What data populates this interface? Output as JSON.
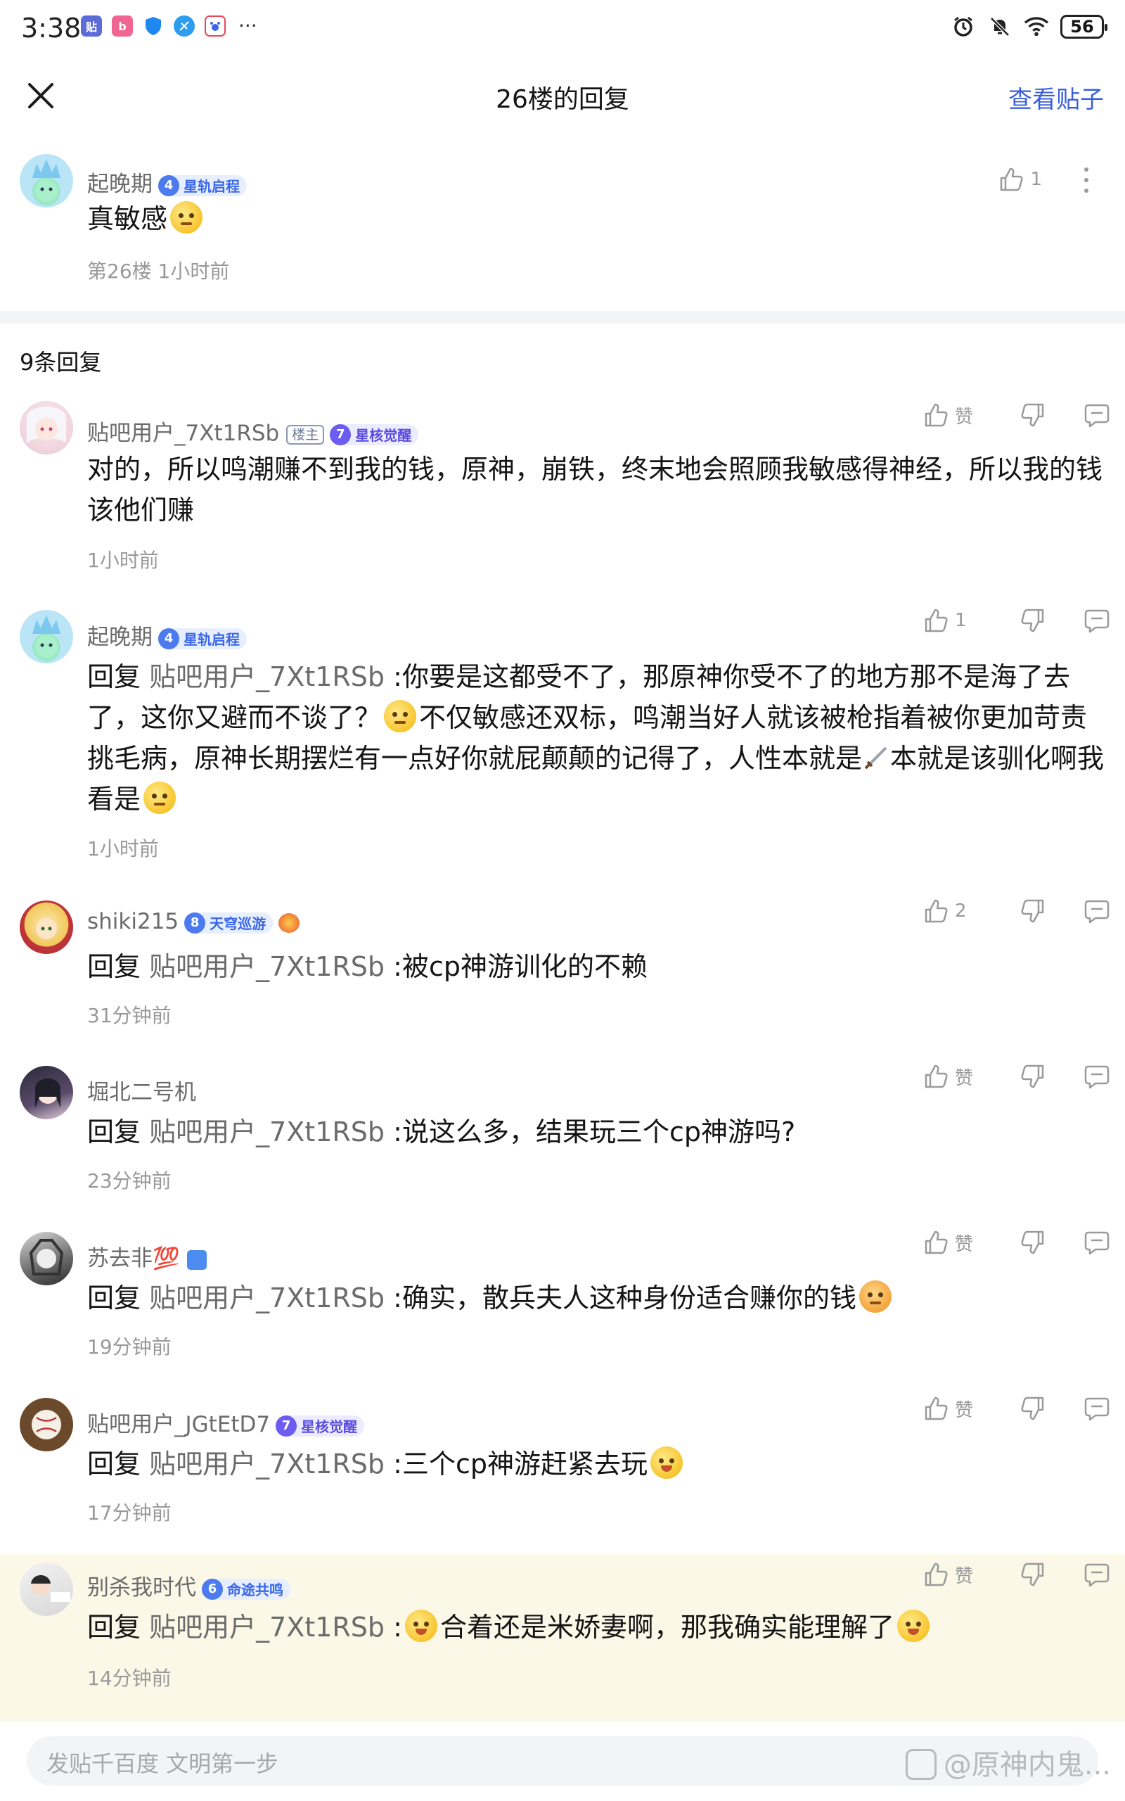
{
  "status_bar": {
    "time": "3:38",
    "battery": "56",
    "app_icons": [
      {
        "name": "tieba-app-icon",
        "color": "#5b6bd8",
        "glyph": "贴"
      },
      {
        "name": "bilibili-app-icon",
        "color": "#f06592",
        "glyph": "b"
      },
      {
        "name": "shield-app-icon",
        "color": "#1e88f0",
        "glyph": ""
      },
      {
        "name": "browser-app-icon",
        "color": "#2e9df0",
        "glyph": ""
      },
      {
        "name": "baidu-app-icon",
        "color": "#e8475a",
        "glyph": ""
      }
    ],
    "more": "···"
  },
  "nav": {
    "title": "26楼的回复",
    "view_post": "查看贴子"
  },
  "main_post": {
    "username": "起晚期",
    "level": "4",
    "badge": "星轨启程",
    "text": "真敏感",
    "floor": "第26楼",
    "time": "1小时前",
    "likes": "1"
  },
  "reply_count": "9条回复",
  "replies": [
    {
      "username": "贴吧用户_7Xt1RSb",
      "owner_tag": "楼主",
      "level": "7",
      "badge": "星核觉醒",
      "reply_prefix": "",
      "at_user": "",
      "text": "对的，所以鸣潮赚不到我的钱，原神，崩铁，终末地会照顾我敏感得神经，所以我的钱该他们赚",
      "time": "1小时前",
      "likes": "赞"
    },
    {
      "username": "起晚期",
      "level": "4",
      "badge": "星轨启程",
      "reply_prefix": "回复",
      "at_user": "贴吧用户_7Xt1RSb",
      "text_parts": [
        ":你要是这都受不了，那原神你受不了的地方那不是海了去了，这你又避而不谈了？",
        "不仅敏感还双标，鸣潮当好人就该被枪指着被你更加苛责挑毛病，原神长期摆烂有一点好你就屁颠颠的记得了，人性本就是",
        "本就是该驯化啊我看是"
      ],
      "time": "1小时前",
      "likes": "1"
    },
    {
      "username": "shiki215",
      "level": "8",
      "badge": "天穹巡游",
      "reply_prefix": "回复",
      "at_user": "贴吧用户_7Xt1RSb",
      "text": ":被cp神游训化的不赖",
      "time": "31分钟前",
      "likes": "2"
    },
    {
      "username": "堀北二号机",
      "reply_prefix": "回复",
      "at_user": "贴吧用户_7Xt1RSb",
      "text": ":说这么多，结果玩三个cp神游吗?",
      "time": "23分钟前",
      "likes": "赞"
    },
    {
      "username": "苏去非💯",
      "reply_prefix": "回复",
      "at_user": "贴吧用户_7Xt1RSb",
      "text": ":确实，散兵夫人这种身份适合赚你的钱",
      "time": "19分钟前",
      "likes": "赞"
    },
    {
      "username": "贴吧用户_JGtEtD7",
      "level": "7",
      "badge": "星核觉醒",
      "reply_prefix": "回复",
      "at_user": "贴吧用户_7Xt1RSb",
      "text": ":三个cp神游赶紧去玩",
      "time": "17分钟前",
      "likes": "赞"
    },
    {
      "username": "别杀我时代",
      "level": "6",
      "badge": "命途共鸣",
      "reply_prefix": "回复",
      "at_user": "贴吧用户_7Xt1RSb",
      "text_parts": [
        ":",
        "合着还是米娇妻啊，那我确实能理解了"
      ],
      "time": "14分钟前",
      "likes": "赞"
    }
  ],
  "input": {
    "placeholder": "发贴千百度 文明第一步"
  },
  "watermark": "@原神内鬼..."
}
